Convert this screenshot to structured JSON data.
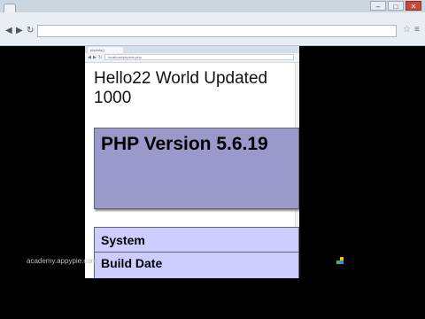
{
  "outer_browser": {
    "window_controls": {
      "minimize": "–",
      "maximize": "□",
      "close": "✕"
    },
    "nav_icons": [
      "arrow-left-icon",
      "arrow-right-icon",
      "reload-icon"
    ]
  },
  "inner_browser": {
    "tab_title": "phpinfo()",
    "address_url": "localhost/phpinfo.php",
    "nav_icons": [
      "arrow-left-icon",
      "arrow-right-icon",
      "reload-icon"
    ]
  },
  "page": {
    "hello_text": "Hello22 World Updated 1000",
    "php_version_heading": "PHP Version 5.6.19",
    "info_rows": [
      "System",
      "Build Date"
    ]
  },
  "watermark": {
    "text": "academy.appypie.com"
  },
  "colors": {
    "php_header_bg": "#9999cc",
    "info_row_bg": "#ccccff",
    "desktop_bg": "#000000"
  }
}
